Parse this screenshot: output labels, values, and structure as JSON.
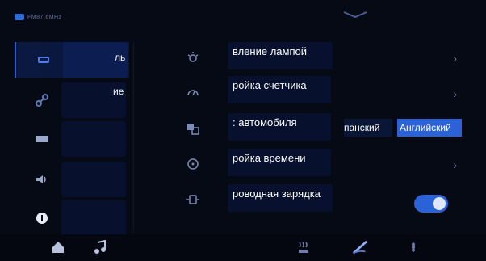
{
  "status": {
    "text": "FM87.6MHz"
  },
  "sidebar": {
    "items": [
      {
        "icon": "car-icon",
        "label": "ль",
        "active": true
      },
      {
        "icon": "link-icon",
        "label": "ие",
        "active": false
      },
      {
        "icon": "display-icon",
        "label": "",
        "active": false
      },
      {
        "icon": "volume-icon",
        "label": "",
        "active": false
      },
      {
        "icon": "info-icon",
        "label": "",
        "active": false
      }
    ]
  },
  "settings": {
    "rows": [
      {
        "icon": "lamp-icon",
        "label": "вление лампой"
      },
      {
        "icon": "gauge-icon",
        "label": "ройка счетчика"
      },
      {
        "icon": "language-icon",
        "label": ": автомобиля"
      },
      {
        "icon": "clock-icon",
        "label": "ройка времени"
      },
      {
        "icon": "wireless-charge-icon",
        "label": "роводная зарядка"
      }
    ],
    "language_options": [
      "панский",
      "Английский"
    ],
    "wireless_charging_on": true
  },
  "bottom_bar": {
    "icons": [
      "home-icon",
      "music-icon",
      "seat-heat-icon",
      "wiper-icon",
      "fan-icon"
    ]
  }
}
